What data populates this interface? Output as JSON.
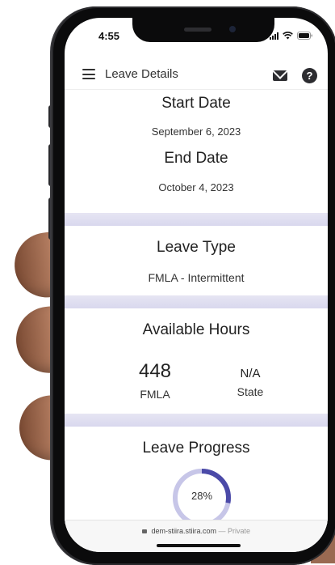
{
  "status_bar": {
    "time": "4:55"
  },
  "app_bar": {
    "title": "Leave Details"
  },
  "dates": {
    "start_label": "Start Date",
    "start_value": "September 6, 2023",
    "end_label": "End Date",
    "end_value": "October 4, 2023"
  },
  "leave_type": {
    "label": "Leave Type",
    "value": "FMLA - Intermittent"
  },
  "available_hours": {
    "label": "Available Hours",
    "fmla_value": "448",
    "fmla_label": "FMLA",
    "state_value": "N/A",
    "state_label": "State"
  },
  "leave_progress": {
    "label": "Leave Progress",
    "percent_text": "28%",
    "percent": 28
  },
  "browser": {
    "url": "dem-stiira.stiira.com",
    "suffix": "— Private"
  },
  "colors": {
    "accent": "#4b4aa8",
    "track": "#c7c6e8",
    "separator": "#e0dff2"
  },
  "icons": [
    "menu-icon",
    "mail-icon",
    "help-icon",
    "lock-icon",
    "wifi-icon",
    "battery-icon",
    "signal-icon"
  ]
}
